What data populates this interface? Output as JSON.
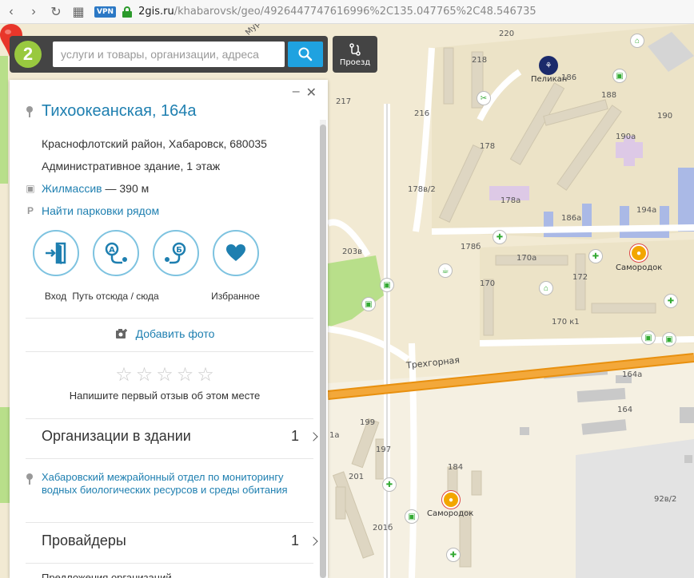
{
  "browser": {
    "url_host": "2gis.ru",
    "url_path": "/khabarovsk/geo/4926447747616996%2C135.047765%2C48.546735",
    "vpn_label": "VPN"
  },
  "search": {
    "placeholder": "услуги и товары, организации, адреса",
    "route_label": "Проезд"
  },
  "place": {
    "title": "Тихоокеанская, 164а",
    "address": "Краснофлотский район, Хабаровск, 680035",
    "description": "Административное здание, 1 этаж",
    "transit_stop": "Жилмассив",
    "transit_distance": " — 390 м",
    "parking_link": "Найти парковки рядом"
  },
  "actions": [
    {
      "label": "Вход"
    },
    {
      "label": "Путь отсюда / сюда"
    },
    {
      "label": "Избранное"
    }
  ],
  "add_photo": "Добавить фото",
  "review": {
    "hint": "Напишите первый отзыв об этом месте",
    "stars_filled": 0,
    "stars_total": 5
  },
  "sections": {
    "organizations": {
      "name": "Организации в здании",
      "count": "1"
    },
    "org_entry": "Хабаровский межрайонный отдел по мониторингу водных биологических ресурсов и среды обитания",
    "providers": {
      "name": "Провайдеры",
      "count": "1"
    },
    "next_section": "Предложения организаций"
  },
  "map": {
    "street_label": "Трехгорная",
    "street_top": "Мур",
    "poi": {
      "pelican": "Пеликан",
      "samorodok1": "Самородок",
      "samorodok2": "Самородок"
    },
    "house_numbers": {
      "h220": "220",
      "h218": "218",
      "h186": "186",
      "h188": "188",
      "h190": "190",
      "h217": "217",
      "h216": "216",
      "h178": "178",
      "h190a": "190а",
      "h178v2": "178в/2",
      "h178a": "178а",
      "h186a": "186а",
      "h194a": "194а",
      "h178b": "178б",
      "h170a": "170а",
      "h203v": "203в",
      "h170": "170",
      "h172": "172",
      "h170k1": "170 к1",
      "h164a": "164а",
      "h164": "164",
      "h199": "199",
      "h197": "197",
      "h184": "184",
      "h201": "201",
      "h201b": "201б",
      "h92v2": "92в/2",
      "h1a": "1а"
    },
    "colors": {
      "background": "#f2ead3",
      "road_orange": "#e8900f",
      "park_green": "#b8df8a",
      "water_blue": "#aab9e6",
      "building": "#d9d2c0",
      "accent_blue": "#1fa2e0",
      "marker_red": "#e8362a"
    }
  }
}
